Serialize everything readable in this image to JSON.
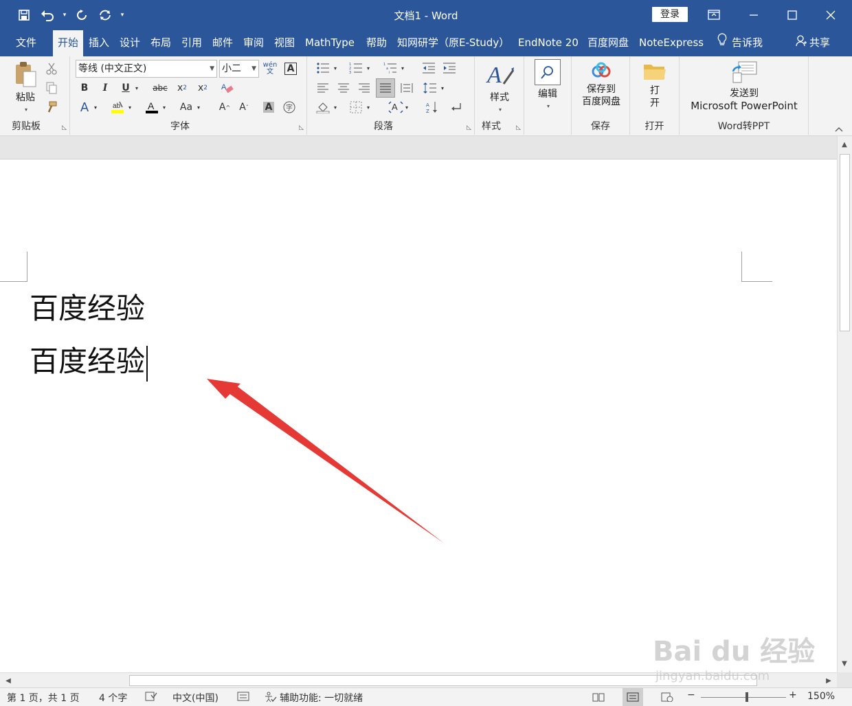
{
  "window": {
    "title": "文档1  -  Word",
    "login_label": "登录"
  },
  "tabs": [
    {
      "label": "文件"
    },
    {
      "label": "开始"
    },
    {
      "label": "插入"
    },
    {
      "label": "设计"
    },
    {
      "label": "布局"
    },
    {
      "label": "引用"
    },
    {
      "label": "邮件"
    },
    {
      "label": "审阅"
    },
    {
      "label": "视图"
    },
    {
      "label": "MathType"
    },
    {
      "label": "帮助"
    },
    {
      "label": "知网研学（原E-Study）"
    },
    {
      "label": "EndNote 20"
    },
    {
      "label": "百度网盘"
    },
    {
      "label": "NoteExpress"
    },
    {
      "label": "告诉我"
    }
  ],
  "share_label": "共享",
  "ribbon": {
    "clipboard": {
      "group_label": "剪贴板",
      "paste_label": "粘贴"
    },
    "font": {
      "group_label": "字体",
      "font_name": "等线 (中文正文)",
      "font_size": "小二",
      "pinyin_glyph": "wén 文",
      "border_glyph": "A"
    },
    "paragraph": {
      "group_label": "段落"
    },
    "styles": {
      "group_label": "样式",
      "styles_label": "样式"
    },
    "editing": {
      "editing_label": "编辑"
    },
    "save": {
      "group_label": "保存",
      "button_line1": "保存到",
      "button_line2": "百度网盘"
    },
    "open": {
      "group_label": "打开",
      "button_line1": "打",
      "button_line2": "开"
    },
    "word2ppt": {
      "group_label": "Word转PPT",
      "button_line1": "发送到",
      "button_line2": "Microsoft PowerPoint"
    }
  },
  "document": {
    "lines": [
      "百度经验",
      "百度经验"
    ]
  },
  "status": {
    "page": "第 1 页，共 1 页",
    "words": "4 个字",
    "language": "中文(中国)",
    "accessibility": "辅助功能: 一切就绪",
    "zoom": "150%",
    "zoom_level_percent": 150
  },
  "watermark": {
    "text": "Bai du 经验",
    "url": "jingyan.baidu.com"
  },
  "colors": {
    "title_bar": "#2b579a",
    "ribbon_bg": "#f3f3f3",
    "annotation_arrow": "#e53935"
  }
}
